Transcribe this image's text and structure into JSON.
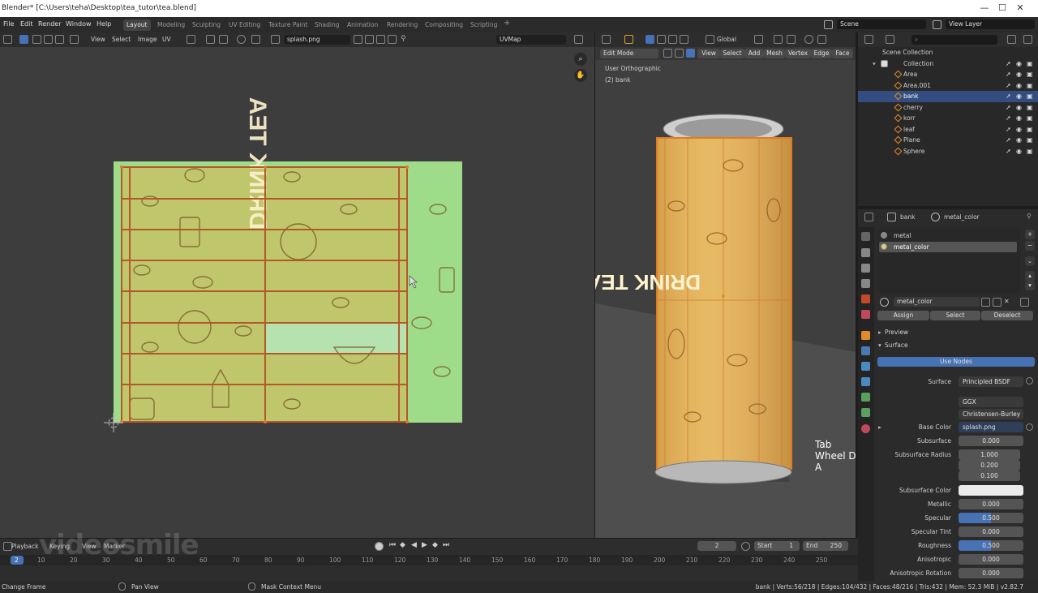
{
  "window": {
    "title": "Blender* [C:\\Users\\teha\\Desktop\\tea_tutor\\tea.blend]",
    "minimize": "—",
    "maximize": "☐",
    "close": "✕"
  },
  "menus": [
    "File",
    "Edit",
    "Render",
    "Window",
    "Help"
  ],
  "workspaces": [
    "Layout",
    "Modeling",
    "Sculpting",
    "UV Editing",
    "Texture Paint",
    "Shading",
    "Animation",
    "Rendering",
    "Compositing",
    "Scripting"
  ],
  "workspace_add": "+",
  "scene": {
    "name": "Scene",
    "view_layer": "View Layer"
  },
  "uv_editor": {
    "header_menus": [
      "View",
      "Select",
      "Image",
      "UV"
    ],
    "image_name": "splash.png",
    "uv_map": "UVMap",
    "texture_text": "DRINK TEA"
  },
  "viewport": {
    "mode": "Edit Mode",
    "header_menus": [
      "View",
      "Select",
      "Add",
      "Mesh",
      "Vertex",
      "Edge",
      "Face"
    ],
    "transform": "Global",
    "view_label": "User Orthographic",
    "object_label": "(2) bank",
    "can_text": "DRINK TEA",
    "key_overlay": [
      "Tab",
      "Wheel D",
      "A"
    ]
  },
  "outliner": {
    "root": "Scene Collection",
    "collection": "Collection",
    "objects": [
      {
        "name": "Area",
        "selected": false
      },
      {
        "name": "Area.001",
        "selected": false
      },
      {
        "name": "bank",
        "selected": true
      },
      {
        "name": "cherry",
        "selected": false
      },
      {
        "name": "korr",
        "selected": false
      },
      {
        "name": "leaf",
        "selected": false
      },
      {
        "name": "Plane",
        "selected": false
      },
      {
        "name": "Sphere",
        "selected": false
      }
    ]
  },
  "properties": {
    "object": "bank",
    "material": "metal_color",
    "slots": [
      {
        "name": "metal",
        "selected": false
      },
      {
        "name": "metal_color",
        "selected": true
      }
    ],
    "material_field": "metal_color",
    "assign": "Assign",
    "select": "Select",
    "deselect": "Deselect",
    "preview": "Preview",
    "surface_panel": "Surface",
    "use_nodes": "Use Nodes",
    "rows": [
      {
        "label": "Surface",
        "value": "Principled BSDF",
        "style": "dark"
      },
      {
        "label": "",
        "value": "GGX",
        "style": "dark"
      },
      {
        "label": "",
        "value": "Christensen-Burley",
        "style": "dark"
      },
      {
        "label": "Base Color",
        "value": "splash.png",
        "style": "link"
      },
      {
        "label": "Subsurface",
        "value": "0.000",
        "style": "num"
      },
      {
        "label": "Subsurface Radius",
        "value": "1.000",
        "style": "num"
      },
      {
        "label": "",
        "value": "0.200",
        "style": "num"
      },
      {
        "label": "",
        "value": "0.100",
        "style": "num"
      },
      {
        "label": "Subsurface Color",
        "value": "",
        "style": "white"
      },
      {
        "label": "Metallic",
        "value": "0.000",
        "style": "num"
      },
      {
        "label": "Specular",
        "value": "0.500",
        "style": "bar"
      },
      {
        "label": "Specular Tint",
        "value": "0.000",
        "style": "num"
      },
      {
        "label": "Roughness",
        "value": "0.500",
        "style": "bar"
      },
      {
        "label": "Anisotropic",
        "value": "0.000",
        "style": "num"
      },
      {
        "label": "Anisotropic Rotation",
        "value": "0.000",
        "style": "num"
      }
    ]
  },
  "timeline": {
    "menus": [
      "Playback",
      "Keying",
      "View",
      "Marker"
    ],
    "current_frame": "2",
    "start_label": "Start",
    "start": "1",
    "end_label": "End",
    "end": "250",
    "ticks": [
      "2",
      "10",
      "20",
      "30",
      "40",
      "50",
      "60",
      "70",
      "80",
      "90",
      "100",
      "110",
      "120",
      "130",
      "140",
      "150",
      "160",
      "170",
      "180",
      "190",
      "200",
      "210",
      "220",
      "230",
      "240",
      "250"
    ]
  },
  "status": {
    "left": "Change Frame",
    "mid": "Pan View",
    "right_hint": "Mask Context Menu",
    "stats": "bank | Verts:56/218 | Edges:104/432 | Faces:48/216 | Tris:432 | Mem: 52.3 MiB | v2.82.7"
  },
  "watermark": "videosmile",
  "colors": {
    "accent": "#4772b3",
    "selected_row": "#334d80",
    "uv_orange": "#e07b22",
    "texture_green": "#9fdc8a"
  }
}
